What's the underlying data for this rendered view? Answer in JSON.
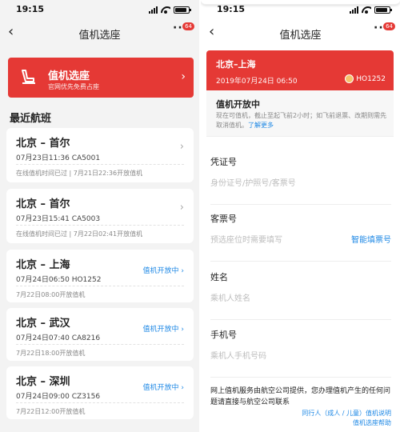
{
  "left": {
    "status_time": "19:15",
    "nav": {
      "title": "值机选座",
      "badge": "64"
    },
    "banner": {
      "title": "值机选座",
      "subtitle": "官网优先免费占座"
    },
    "section_title": "最近航班",
    "flights": [
      {
        "route": "北京 – 首尔",
        "date": "07月23日11:36 CA5001",
        "note": "在线值机时间已过 | 7月21日22:36开放值机",
        "status": ""
      },
      {
        "route": "北京 – 首尔",
        "date": "07月23日15:41 CA5003",
        "note": "在线值机时间已过 | 7月22日02:41开放值机",
        "status": ""
      },
      {
        "route": "北京 – 上海",
        "date": "07月24日06:50 HO1252",
        "note": "7月22日08:00开放值机",
        "status": "值机开放中"
      },
      {
        "route": "北京 – 武汉",
        "date": "07月24日07:40 CA8216",
        "note": "7月22日18:00开放值机",
        "status": "值机开放中"
      },
      {
        "route": "北京 – 深圳",
        "date": "07月24日09:00 CZ3156",
        "note": "7月22日12:00开放值机",
        "status": "值机开放中"
      }
    ]
  },
  "right": {
    "status_time": "19:15",
    "nav": {
      "title": "值机选座",
      "badge": "64"
    },
    "flight": {
      "route": "北京–上海",
      "datetime": "2019年07月24日 06:50",
      "flight_no": "HO1252"
    },
    "open": {
      "title": "值机开放中",
      "desc": "现在可值机，截止至起飞前2小时；如飞前退票、改期则需先取消值机。",
      "link": "了解更多"
    },
    "fields": [
      {
        "label": "凭证号",
        "placeholder": "身份证号/护照号/客票号",
        "action": ""
      },
      {
        "label": "客票号",
        "placeholder": "预选座位时需要填写",
        "action": "智能填票号"
      },
      {
        "label": "姓名",
        "placeholder": "乘机人姓名",
        "action": ""
      },
      {
        "label": "手机号",
        "placeholder": "乘机人手机号码",
        "action": ""
      }
    ],
    "footer": "网上值机服务由航空公司提供，您办理值机产生的任何问题请直接与航空公司联系",
    "links": [
      "同行人（成人 / 儿童）值机说明",
      "值机选座帮助"
    ]
  },
  "colors": {
    "accent_red": "#e53935",
    "link_blue": "#1e88e5"
  },
  "icons": [
    "back-arrow-icon",
    "more-icon",
    "seat-icon",
    "chevron-right-icon",
    "airline-logo-icon"
  ]
}
